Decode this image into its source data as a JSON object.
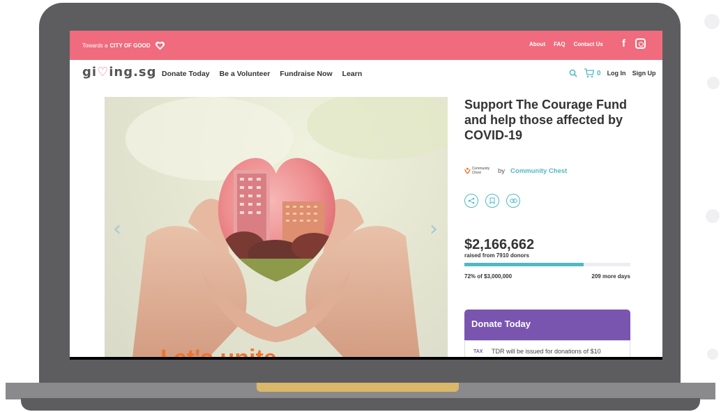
{
  "topbar": {
    "tagline_prefix": "Towards a",
    "tagline_brand": "CITY OF GOOD",
    "links": [
      "About",
      "FAQ",
      "Contact Us"
    ],
    "facebook_glyph": "f",
    "color": "#f06b7d"
  },
  "nav": {
    "logo_start": "gi",
    "logo_heart": "♡",
    "logo_end": "ing.sg",
    "links": [
      "Donate Today",
      "Be a Volunteer",
      "Fundraise Now",
      "Learn"
    ],
    "cart_count": "0",
    "login": "Log In",
    "signup": "Sign Up"
  },
  "hero": {
    "prev_arrow": "‹",
    "next_arrow": "›",
    "caption_partial": "I et's unite"
  },
  "campaign": {
    "title": "Support The Courage Fund and help those affected by COVID-19",
    "by": "by",
    "organization": "Community Chest",
    "org_logo_text": "Community Chest",
    "raised": "$2,166,662",
    "donors_text": "raised from 7910 donors",
    "progress_percent": 72,
    "progress_text": "72% of $3,000,000",
    "days_left": "209 more days",
    "donate_heading": "Donate Today",
    "tax_badge": "TAX",
    "tax_text": "TDR will be issued for donations of $10"
  },
  "colors": {
    "accent": "#4fb9c4",
    "donate_purple": "#7a55b0",
    "laptop_body": "#5d5d60"
  }
}
